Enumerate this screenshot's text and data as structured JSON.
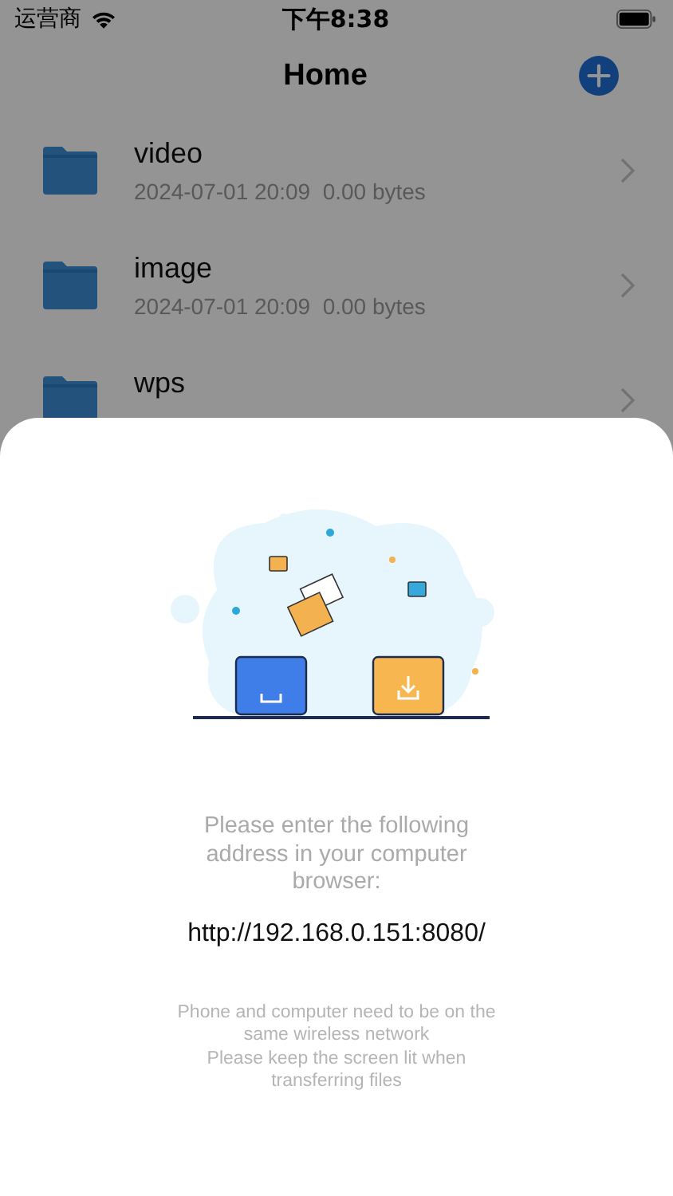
{
  "status_bar": {
    "carrier": "运营商",
    "time": "下午8:38"
  },
  "nav_bar": {
    "title": "Home"
  },
  "files": [
    {
      "name": "video",
      "meta": "2024-07-01 20:09  0.00 bytes"
    },
    {
      "name": "image",
      "meta": "2024-07-01 20:09  0.00 bytes"
    },
    {
      "name": "wps"
    }
  ],
  "sheet": {
    "prompt": "Please enter the following address in your computer browser:",
    "address": "http://192.168.0.151:8080/",
    "hints": [
      "Phone and computer need to be on the same wireless network",
      "Please keep the screen lit when transferring files"
    ]
  }
}
